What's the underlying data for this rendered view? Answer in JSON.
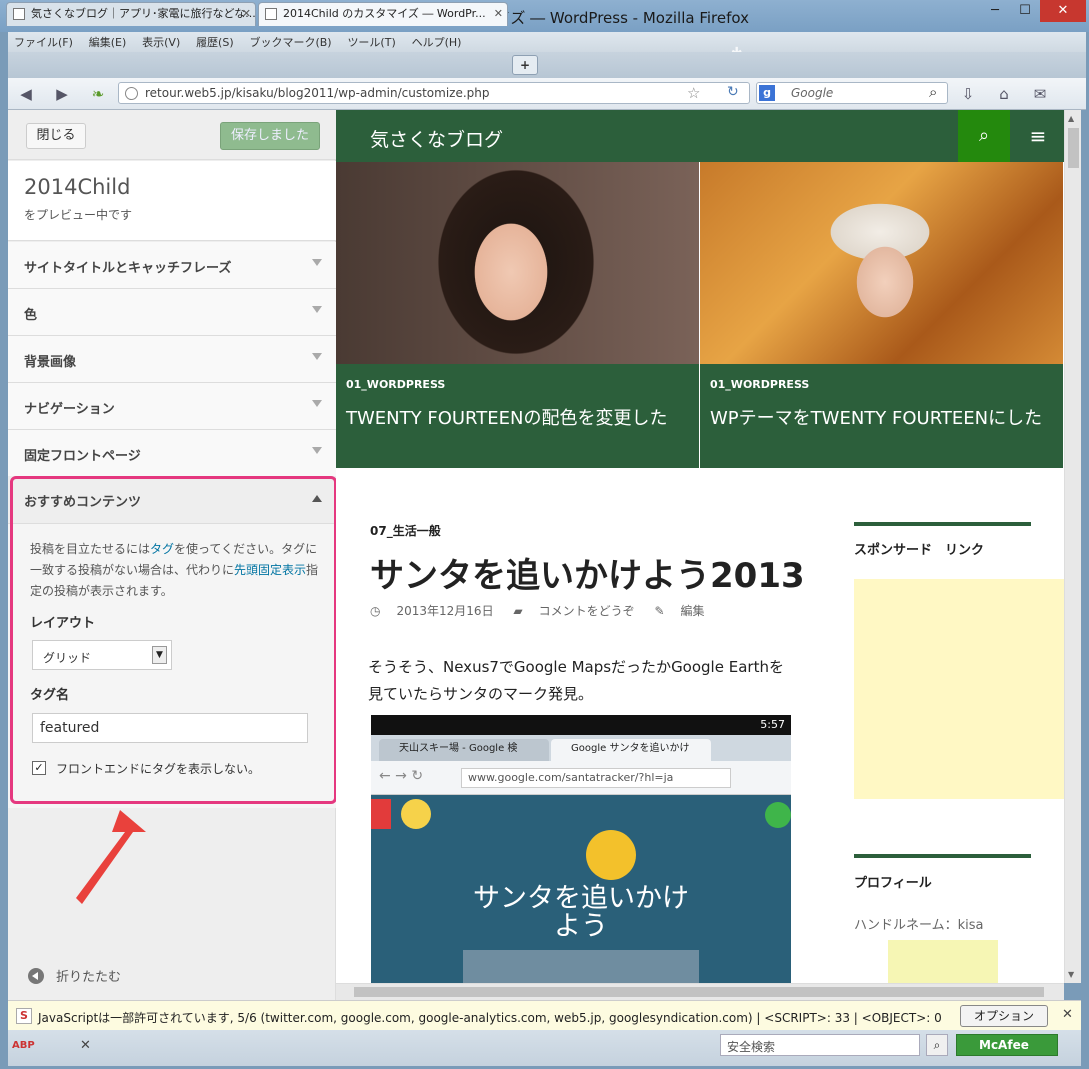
{
  "window": {
    "title": "2014Child のカスタマイズ ― WordPress - Mozilla Firefox",
    "min": "─",
    "max": "☐",
    "close": "✕"
  },
  "menu": [
    "ファイル(F)",
    "編集(E)",
    "表示(V)",
    "履歴(S)",
    "ブックマーク(B)",
    "ツール(T)",
    "ヘルプ(H)"
  ],
  "tabs": [
    {
      "label": "気さくなブログ｜アプリ･家電に旅行などな...",
      "active": false
    },
    {
      "label": "2014Child のカスタマイズ ― WordPr...",
      "active": true
    }
  ],
  "address": {
    "url": "retour.web5.jp/kisaku/blog2011/wp-admin/customize.php",
    "search_placeholder": "Google"
  },
  "customizer": {
    "close_label": "閉じる",
    "saved_label": "保存しました",
    "theme_name": "2014Child",
    "preview_note": "をプレビュー中です",
    "sections": [
      "サイトタイトルとキャッチフレーズ",
      "色",
      "背景画像",
      "ナビゲーション",
      "固定フロントページ"
    ],
    "featured": {
      "title": "おすすめコンテンツ",
      "desc_1": "投稿を目立たせるには",
      "desc_link1": "タグ",
      "desc_2": "を使ってください。タグに一致する投稿がない場合は、代わりに",
      "desc_link2": "先頭固定表示",
      "desc_3": "指定の投稿が表示されます。",
      "layout_label": "レイアウト",
      "layout_value": "グリッド",
      "tag_label": "タグ名",
      "tag_value": "featured",
      "checkbox_label": "フロントエンドにタグを表示しない。",
      "checkbox_checked": true
    },
    "collapse_label": "折りたたむ"
  },
  "preview": {
    "site_title": "気さくなブログ",
    "header_color": "#2c5f3b",
    "featured_posts": [
      {
        "category": "01_WORDPRESS",
        "title": "TWENTY FOURTEENの配色を変更した"
      },
      {
        "category": "01_WORDPRESS",
        "title": "WPテーマをTWENTY FOURTEENにした"
      }
    ],
    "post": {
      "category": "07_生活一般",
      "title": "サンタを追いかけよう2013",
      "date": "2013年12月16日",
      "comments": "コメントをどうぞ",
      "edit": "編集",
      "body": "そうそう、Nexus7でGoogle MapsだったかGoogle Earthを見ていたらサンタのマーク発見。",
      "shot": {
        "time": "5:57",
        "tab1": "天山スキー場 - Google 検",
        "tab2": "Google サンタを追いかけ",
        "url": "www.google.com/santatracker/?hl=ja",
        "title_line1": "サンタを追いかけ",
        "title_line2": "よう"
      }
    },
    "widgets": [
      {
        "title": "スポンサード　リンク"
      },
      {
        "title": "プロフィール",
        "text": "ハンドルネーム：kisa"
      }
    ]
  },
  "noscript": {
    "message": "JavaScriptは一部許可されています, 5/6 (twitter.com, google.com, google-analytics.com, web5.jp, googlesyndication.com) | <SCRIPT>: 33 | <OBJECT>: 0",
    "options": "オプション(O)..."
  },
  "addonbar": {
    "abp": "ABP",
    "search_placeholder": "安全検索",
    "mcafee": "McAfee"
  }
}
